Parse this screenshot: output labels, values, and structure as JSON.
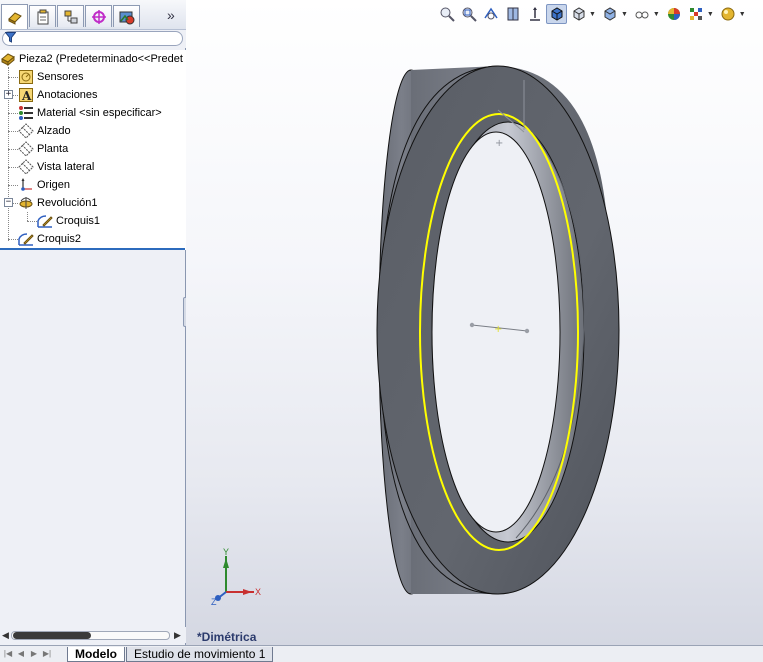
{
  "feature_manager": {
    "tabs": [
      {
        "name": "feature-manager-tab",
        "icon": "feature-tree-icon"
      },
      {
        "name": "property-manager-tab",
        "icon": "property-manager-icon"
      },
      {
        "name": "configuration-manager-tab",
        "icon": "configuration-manager-icon"
      },
      {
        "name": "dimxpert-manager-tab",
        "icon": "dimxpert-icon"
      },
      {
        "name": "display-manager-tab",
        "icon": "display-manager-icon"
      }
    ],
    "more_label": "»",
    "filter_icon": "filter-icon",
    "tree": [
      {
        "label": "Pieza2  (Predeterminado<<Predet",
        "icon": "part-icon"
      },
      {
        "label": "Sensores",
        "icon": "sensors-icon"
      },
      {
        "label": "Anotaciones",
        "icon": "annotations-icon"
      },
      {
        "label": "Material <sin especificar>",
        "icon": "material-icon"
      },
      {
        "label": "Alzado",
        "icon": "plane-icon"
      },
      {
        "label": "Planta",
        "icon": "plane-icon"
      },
      {
        "label": "Vista lateral",
        "icon": "plane-icon"
      },
      {
        "label": "Origen",
        "icon": "origin-icon"
      },
      {
        "label": "Revolución1",
        "icon": "revolve-icon"
      },
      {
        "label": "Croquis1",
        "icon": "sketch-icon"
      },
      {
        "label": "Croquis2",
        "icon": "sketch-icon"
      }
    ],
    "expander_plus": "+",
    "expander_minus": "−"
  },
  "view_toolbar": {
    "icons": [
      "zoom-to-fit-icon",
      "zoom-to-area-icon",
      "previous-view-icon",
      "section-view-icon",
      "view-orientation-icon",
      "shaded-with-edges-icon",
      "display-style-icon",
      "hide-show-items-icon",
      "edit-appearance-icon",
      "apply-scene-icon",
      "view-settings-icon"
    ]
  },
  "viewport": {
    "view_name": "*Dimétrica",
    "triad": {
      "x_label": "X",
      "y_label": "Y",
      "z_label": "Z"
    }
  },
  "bottom_tabs": {
    "nav_arrows": [
      "|◀",
      "◀",
      "▶",
      "▶|"
    ],
    "tabs": [
      "Modelo",
      "Estudio de movimiento 1"
    ],
    "active": "Modelo"
  },
  "colors": {
    "model_body": "#6b6f78",
    "selected_edge": "#ffff00",
    "tree_selection_line": "#2c6bbd"
  }
}
